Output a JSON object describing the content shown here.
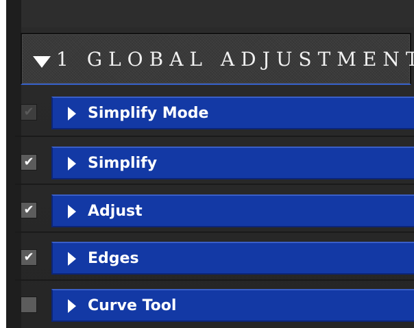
{
  "section": {
    "title": "1 GLOBAL ADJUSTMENT",
    "expanded": true,
    "icon": "triangle-down-icon"
  },
  "items": [
    {
      "label": "Simplify Mode",
      "checked": true,
      "enabled": false,
      "icon": "triangle-right-icon"
    },
    {
      "label": "Simplify",
      "checked": true,
      "enabled": true,
      "icon": "triangle-right-icon"
    },
    {
      "label": "Adjust",
      "checked": true,
      "enabled": true,
      "icon": "triangle-right-icon"
    },
    {
      "label": "Edges",
      "checked": true,
      "enabled": true,
      "icon": "triangle-right-icon"
    },
    {
      "label": "Curve Tool",
      "checked": false,
      "enabled": true,
      "icon": "triangle-right-icon"
    }
  ],
  "colors": {
    "bar_blue": "#1339a5",
    "background": "#2b2b2b",
    "check_mark": "#ffffff"
  },
  "check_glyph": "✔"
}
